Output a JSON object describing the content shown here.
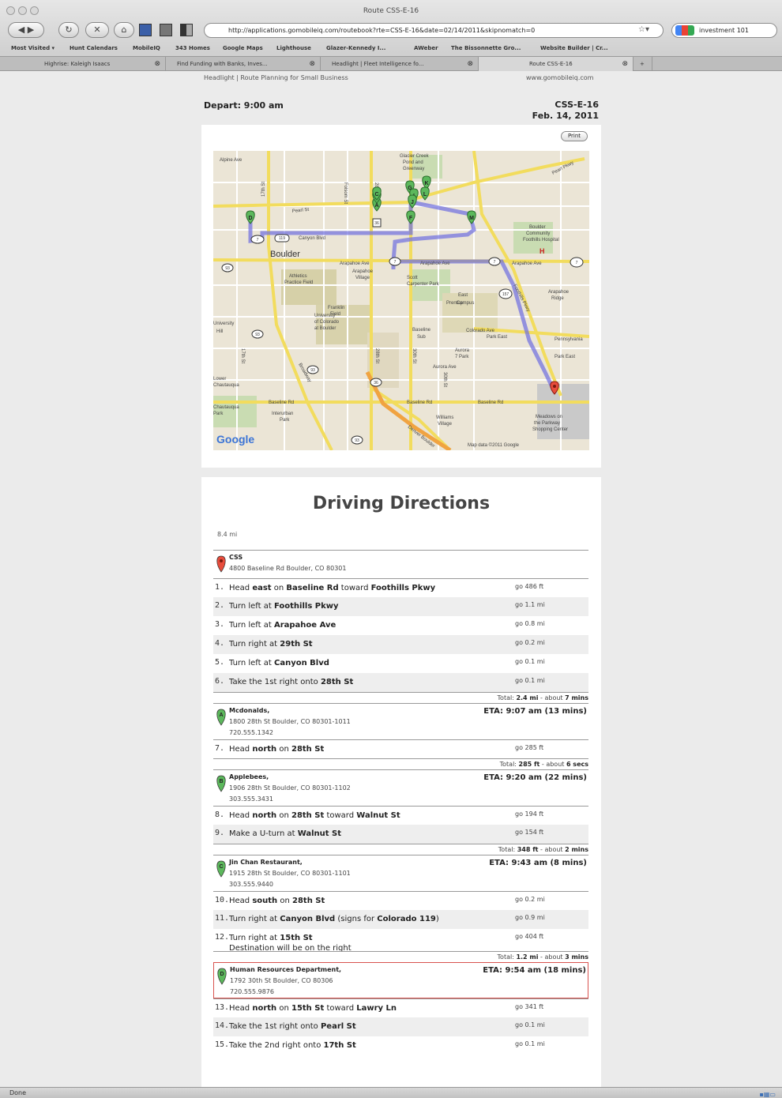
{
  "window": {
    "title": "Route CSS-E-16"
  },
  "nav": {
    "url": "http://applications.gomobileiq.com/routebook?rte=CSS-E-16&date=02/14/2011&skipnomatch=0",
    "search_value": "investment 101",
    "bookmarks": [
      "Most Visited ▾",
      "Hunt Calendars",
      "MobileIQ",
      "343 Homes",
      "Google Maps",
      "Lighthouse",
      "Glazer-Kennedy I...",
      "AWeber",
      "The Bissonnette Gro...",
      "Website Builder | Cr..."
    ],
    "tabs": [
      "Highrise: Kaleigh Isaacs",
      "Find Funding with Banks, Inves...",
      "Headlight | Fleet Intelligence fo...",
      "Route CSS-E-16"
    ]
  },
  "header": {
    "left": "Headlight | Route Planning for Small Business",
    "right": "www.gomobileiq.com"
  },
  "depart": "Depart: 9:00 am",
  "route": {
    "id": "CSS-E-16",
    "date": "Feb. 14, 2011"
  },
  "print_label": "Print",
  "map": {
    "city": "Boulder",
    "attribution": "Map data ©2011 Google",
    "logo": "Google",
    "labels": [
      "Alpine Ave",
      "Pearl St",
      "Canyon Blvd",
      "Arapahoe Ave",
      "Colorado Ave",
      "Baseline Rd",
      "Aurora Ave",
      "Pennsylvania",
      "Park East",
      "Arapahoe Ridge",
      "Foothills Pkwy",
      "University Hill",
      "Chautauqua Park",
      "Interurban Park",
      "Athletics Practice Field",
      "Arapahoe Village",
      "Scott Carpenter Park",
      "East Campus",
      "Baseline Sub",
      "Meadows on the Parkway Shopping Center",
      "Williams Village",
      "Boulder Community Foothills Hospital",
      "28th St",
      "30th St",
      "17th St",
      "Broadway",
      "Folsom St",
      "Denver Boulder",
      "Pearl Pkwy",
      "Glacier Creek Pond and Greenway",
      "Lower Chautauqua",
      "Aurora 7 Park",
      "Franklin Field",
      "University of Colorado at Boulder",
      "Park East"
    ],
    "markers": [
      "A",
      "B",
      "C",
      "D",
      "E",
      "F",
      "G",
      "H",
      "I",
      "J",
      "K",
      "L",
      "M"
    ]
  },
  "directions": {
    "title": "Driving Directions",
    "distance": "8.4 mi",
    "start": {
      "name": "CSS",
      "address": "4800 Baseline Rd Boulder, CO 80301"
    },
    "steps1": [
      {
        "n": "1.",
        "html": "Head <b>east</b> on <b>Baseline Rd</b> toward <b>Foothills Pkwy</b>",
        "go": "go 486 ft"
      },
      {
        "n": "2.",
        "html": "Turn left at <b>Foothills Pkwy</b>",
        "go": "go 1.1 mi"
      },
      {
        "n": "3.",
        "html": "Turn left at <b>Arapahoe Ave</b>",
        "go": "go 0.8 mi"
      },
      {
        "n": "4.",
        "html": "Turn right at <b>29th St</b>",
        "go": "go 0.2 mi"
      },
      {
        "n": "5.",
        "html": "Turn left at <b>Canyon Blvd</b>",
        "go": "go 0.1 mi"
      },
      {
        "n": "6.",
        "html": "Take the 1st right onto <b>28th St</b>",
        "go": "go 0.1 mi"
      }
    ],
    "total1": "Total: <b>2.4 mi</b> - about <b>7 mins</b>",
    "stopA": {
      "letter": "A",
      "name": "Mcdonalds,",
      "address": "1800 28th St Boulder, CO 80301-1011",
      "phone": "720.555.1342",
      "eta": "ETA: 9:07 am (13 mins)"
    },
    "steps2": [
      {
        "n": "7.",
        "html": "Head <b>north</b> on <b>28th St</b>",
        "go": "go 285 ft"
      }
    ],
    "total2": "Total: <b>285 ft</b> - about <b>6 secs</b>",
    "stopB": {
      "letter": "B",
      "name": "Applebees,",
      "address": "1906 28th St Boulder, CO 80301-1102",
      "phone": "303.555.3431",
      "eta": "ETA: 9:20 am (22 mins)"
    },
    "steps3": [
      {
        "n": "8.",
        "html": "Head <b>north</b> on <b>28th St</b> toward <b>Walnut St</b>",
        "go": "go 194 ft"
      },
      {
        "n": "9.",
        "html": "Make a U-turn at <b>Walnut St</b>",
        "go": "go 154 ft"
      }
    ],
    "total3": "Total: <b>348 ft</b> - about <b>2 mins</b>",
    "stopC": {
      "letter": "C",
      "name": "Jin Chan Restaurant,",
      "address": "1915 28th St Boulder, CO 80301-1101",
      "phone": "303.555.9440",
      "eta": "ETA: 9:43 am (8 mins)"
    },
    "steps4": [
      {
        "n": "10.",
        "html": "Head <b>south</b> on <b>28th St</b>",
        "go": "go 0.2 mi"
      },
      {
        "n": "11.",
        "html": "Turn right at <b>Canyon Blvd</b> (signs for <b>Colorado 119</b>)",
        "go": "go 0.9 mi"
      },
      {
        "n": "12.",
        "html": "Turn right at <b>15th St</b><br><span style=\"font-weight:normal\">Destination will be on the right</span>",
        "go": "go 404 ft"
      }
    ],
    "total4": "Total: <b>1.2 mi</b> - about <b>3 mins</b>",
    "stopD": {
      "letter": "D",
      "name": "Human Resources Department,",
      "address": "1792 30th St Boulder, CO 80306",
      "phone": "720.555.9876",
      "eta": "ETA: 9:54 am (18 mins)"
    },
    "steps5": [
      {
        "n": "13.",
        "html": "Head <b>north</b> on <b>15th St</b> toward <b>Lawry Ln</b>",
        "go": "go 341 ft"
      },
      {
        "n": "14.",
        "html": "Take the 1st right onto <b>Pearl St</b>",
        "go": "go 0.1 mi"
      },
      {
        "n": "15.",
        "html": "Take the 2nd right onto <b>17th St</b>",
        "go": "go 0.1 mi"
      }
    ]
  },
  "status": "Done"
}
